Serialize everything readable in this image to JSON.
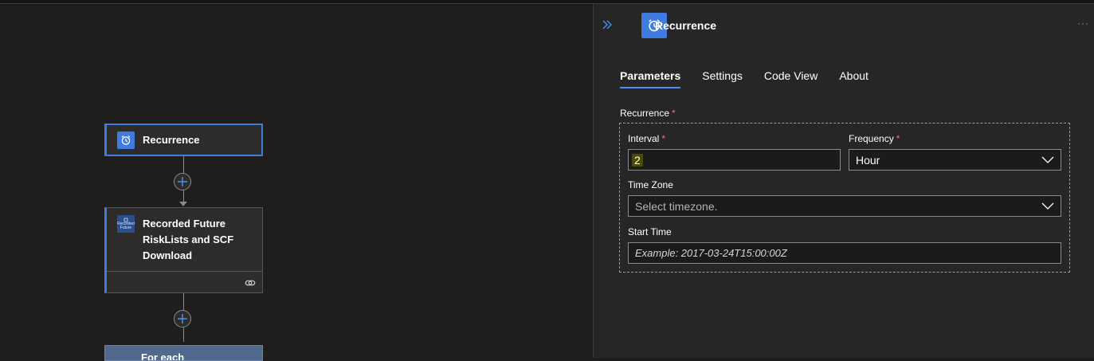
{
  "canvas": {
    "nodes": [
      {
        "title": "Recurrence",
        "icon": "alarm-clock-icon"
      },
      {
        "title_lines": [
          "Recorded Future",
          "RiskLists and SCF",
          "Download"
        ],
        "icon": "recorded-future-logo-icon",
        "icon_text": [
          "Recorded",
          "Future"
        ]
      }
    ],
    "partial_node_title": "For each"
  },
  "panel": {
    "title": "Recurrence",
    "icon": "alarm-clock-icon",
    "more": "···",
    "tabs": [
      "Parameters",
      "Settings",
      "Code View",
      "About"
    ],
    "active_tab": "Parameters",
    "recurrence": {
      "label": "Recurrence",
      "required_mark": "*",
      "interval": {
        "label": "Interval",
        "value": "2"
      },
      "frequency": {
        "label": "Frequency",
        "value": "Hour"
      },
      "time_zone": {
        "label": "Time Zone",
        "placeholder": "Select timezone."
      },
      "start_time": {
        "label": "Start Time",
        "placeholder": "Example: 2017-03-24T15:00:00Z"
      }
    }
  },
  "colors": {
    "accent": "#3f7be0",
    "background": "#1f1e1d",
    "panel": "#262626",
    "required": "#f1707b"
  }
}
